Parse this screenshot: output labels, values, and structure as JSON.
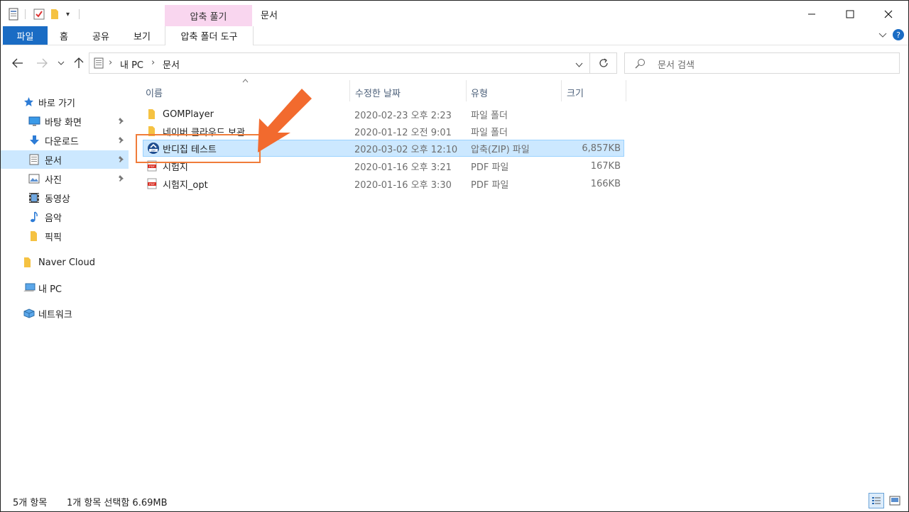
{
  "window": {
    "title": "문서",
    "context_tab_group": "압축 풀기"
  },
  "ribbon": {
    "tabs": [
      "파일",
      "홈",
      "공유",
      "보기"
    ],
    "context_tab": "압축 폴더 도구"
  },
  "address": {
    "crumbs": [
      "내 PC",
      "문서"
    ]
  },
  "search": {
    "placeholder": "문서 검색"
  },
  "sidebar": {
    "quick_access": "바로 가기",
    "items": [
      {
        "label": "바탕 화면",
        "icon": "desktop-icon",
        "pinned": true
      },
      {
        "label": "다운로드",
        "icon": "download-icon",
        "pinned": true
      },
      {
        "label": "문서",
        "icon": "documents-icon",
        "pinned": true,
        "selected": true
      },
      {
        "label": "사진",
        "icon": "pictures-icon",
        "pinned": true
      },
      {
        "label": "동영상",
        "icon": "videos-icon"
      },
      {
        "label": "음악",
        "icon": "music-icon"
      },
      {
        "label": "픽픽",
        "icon": "folder-icon"
      }
    ],
    "naver_cloud": "Naver Cloud",
    "this_pc": "내 PC",
    "network": "네트워크"
  },
  "columns": {
    "name": "이름",
    "date": "수정한 날짜",
    "type": "유형",
    "size": "크기"
  },
  "files": [
    {
      "name": "GOMPlayer",
      "date": "2020-02-23 오후 2:23",
      "type": "파일 폴더",
      "size": "",
      "icon": "folder-icon"
    },
    {
      "name": "네이버 클라우드 보관",
      "date": "2020-01-12 오전 9:01",
      "type": "파일 폴더",
      "size": "",
      "icon": "folder-icon"
    },
    {
      "name": "반디집 테스트",
      "date": "2020-03-02 오후 12:10",
      "type": "압축(ZIP) 파일",
      "size": "6,857KB",
      "icon": "zip-icon",
      "selected": true
    },
    {
      "name": "시험지",
      "date": "2020-01-16 오후 3:21",
      "type": "PDF 파일",
      "size": "167KB",
      "icon": "pdf-icon"
    },
    {
      "name": "시험지_opt",
      "date": "2020-01-16 오후 3:30",
      "type": "PDF 파일",
      "size": "166KB",
      "icon": "pdf-icon"
    }
  ],
  "status": {
    "count": "5개 항목",
    "selection": "1개 항목 선택함 6.69MB"
  },
  "colors": {
    "accent": "#1a6cc4",
    "selection": "#cce8ff",
    "context_tab": "#f9d6ef",
    "arrow": "#f26a2e"
  }
}
